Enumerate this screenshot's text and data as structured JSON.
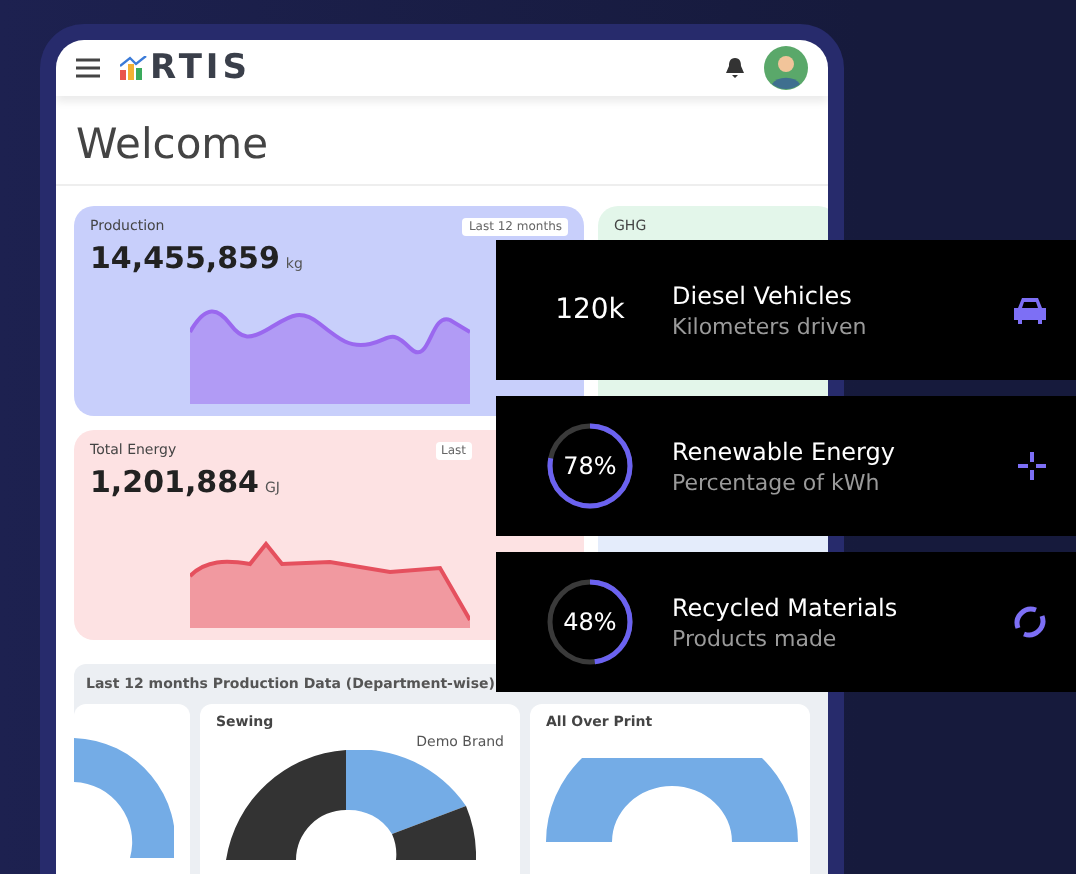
{
  "header": {
    "logo": "RTIS"
  },
  "page_title": "Welcome",
  "metric_cards": [
    {
      "title": "Production",
      "value": "14,455,859",
      "unit": "kg",
      "badge": "Last 12 months",
      "color": "#c8cffb"
    },
    {
      "title": "Total Energy",
      "value": "1,201,884",
      "unit": "GJ",
      "badge": "Last",
      "color": "#fde2e3"
    }
  ],
  "ghg_card": {
    "title": "GHG"
  },
  "highlights": [
    {
      "kind": "number",
      "value": "120k",
      "title": "Diesel Vehicles",
      "subtitle": "Kilometers driven"
    },
    {
      "kind": "ring",
      "value": "78%",
      "level": 0.78,
      "title": "Renewable Energy",
      "subtitle": "Percentage of kWh"
    },
    {
      "kind": "ring",
      "value": "48%",
      "level": 0.48,
      "title": "Recycled Materials",
      "subtitle": "Products made"
    }
  ],
  "department_section": {
    "title": "Last 12 months Production Data (Department-wise)",
    "panels": [
      {
        "kind": "partial"
      },
      {
        "kind": "split",
        "title": "Sewing",
        "legend_label": "Demo Brand"
      },
      {
        "kind": "full",
        "title": "All Over Print"
      }
    ]
  }
}
